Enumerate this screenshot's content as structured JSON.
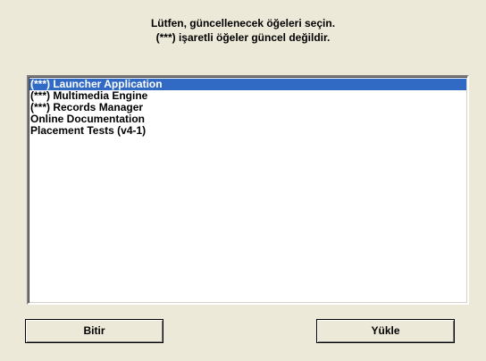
{
  "dialog": {
    "instruction_line1": "Lütfen, güncellenecek öğeleri seçin.",
    "instruction_line2": "(***) işaretli öğeler güncel değildir."
  },
  "list": {
    "items": [
      {
        "label": "(***) Launcher Application",
        "selected": true
      },
      {
        "label": "(***) Multimedia Engine",
        "selected": false
      },
      {
        "label": "(***) Records Manager",
        "selected": false
      },
      {
        "label": "Online Documentation",
        "selected": false
      },
      {
        "label": "Placement Tests (v4-1)",
        "selected": false
      }
    ],
    "selection_color": "#316ac5"
  },
  "buttons": {
    "finish_label": "Bitir",
    "install_label": "Yükle"
  },
  "colors": {
    "dialog_background": "#ece9d8",
    "list_background": "#ffffff"
  }
}
